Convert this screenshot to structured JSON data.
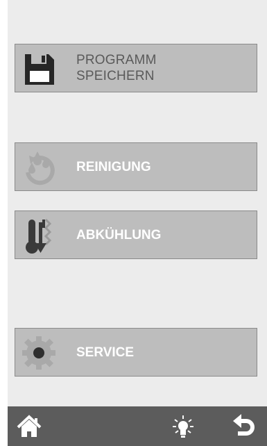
{
  "menu": {
    "save_program": {
      "line1": "PROGRAMM",
      "line2": "SPEICHERN",
      "icon": "floppy-disk-icon"
    },
    "cleaning": {
      "label": "REINIGUNG",
      "icon": "water-drops-refresh-icon"
    },
    "cooling": {
      "label": "ABKÜHLUNG",
      "icon": "thermometer-down-icon"
    },
    "service": {
      "label": "SERVICE",
      "icon": "gear-icon"
    }
  },
  "bottom_bar": {
    "home": {
      "icon": "home-icon"
    },
    "light": {
      "icon": "light-bulb-icon"
    },
    "back": {
      "icon": "back-arrow-icon"
    }
  },
  "colors": {
    "button_bg": "#bdbdbd",
    "screen_bg": "#ececec",
    "bar_bg": "#5c5c5c"
  }
}
